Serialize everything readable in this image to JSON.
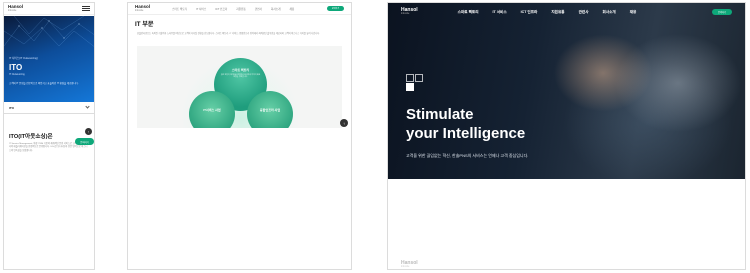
{
  "brand": {
    "logo": "Hansol",
    "logo_sub": "Inticube"
  },
  "mobile": {
    "hero_eyebrow": "IT 서비스(IT Outsourcing)",
    "hero_title": "ITO",
    "hero_subtitle": "IT Outsourcing",
    "hero_desc": "고객의 IT 운영을 전문적으로 책임지고 효율적인 IT 환경을 제공합니다.",
    "tab_label": "ITO",
    "section_title": "ITO(IT아웃소싱)은",
    "section_desc": "IT Service Management, 약칭 ITSM 기반의 체계적인 운영 서비스로 고객사의 IT 인프라와 애플리케이션을 안정적으로 운영합니다. 24시간 모니터링과 전문 인력으로 비즈니스의 연속성을 보장합니다.",
    "top_button": "↑",
    "cta_label": "문의하기"
  },
  "tablet": {
    "nav": [
      "스마트 팩토리",
      "IT 서비스",
      "ICT 인프라",
      "지원유통",
      "관련사",
      "회사소개",
      "채용"
    ],
    "cta_label": "문의하기",
    "page_title": "IT 부문",
    "page_desc": "한솔인티큐브는 축적된 기술력과 노하우를 바탕으로 고객의 디지털 전환을 선도합니다. 스마트 팩토리, IT 서비스, 융합인프라 영역에서 최적화된 솔루션을 제공하며 고객의 비즈니스 가치를 높여 나갑니다.",
    "circles": [
      {
        "title": "스마트 팩토리",
        "desc": "생산 현장의 데이터를 연결하고 분석하여 최적의 제조 환경을 구현합니다."
      },
      {
        "title": "IT서비스 사업",
        "desc": ""
      },
      {
        "title": "융합인프라 사업",
        "desc": ""
      }
    ],
    "top_button": "↑"
  },
  "desktop": {
    "nav": [
      "스마트 팩토리",
      "IT 서비스",
      "ICT 인프라",
      "지원유통",
      "관련사",
      "회사소개",
      "채용"
    ],
    "cta_label": "문의하기",
    "headline_line1": "Stimulate",
    "headline_line2": "your Intelligence",
    "subline": "고객을 위한 끊임없는 혁신, 한솔PNS의 서비스는 언제나 고객 중심입니다."
  }
}
